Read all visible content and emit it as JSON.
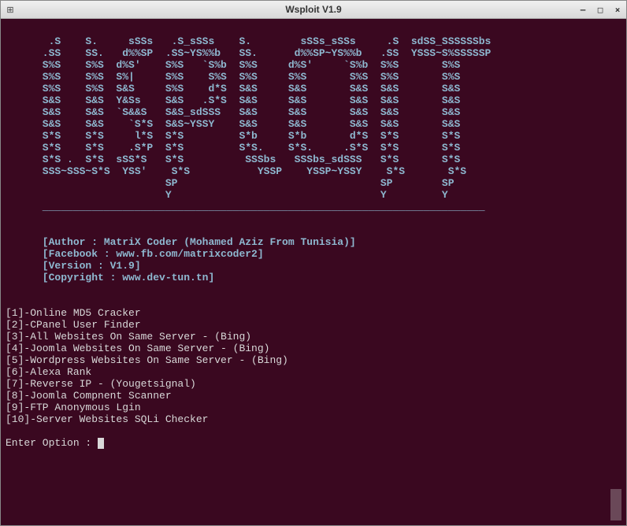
{
  "window": {
    "title": "Wsploit V1.9"
  },
  "ascii_art": "       .S    S.     sSSs   .S_sSSs    S.        sSSs_sSSs     .S  sdSS_SSSSSSbs\n      .SS    SS.   d%%SP  .SS~YS%%b   SS.      d%%SP~YS%%b   .SS  YSSS~S%SSSSSP\n      S%S    S%S  d%S'    S%S   `S%b  S%S     d%S'     `S%b  S%S       S%S\n      S%S    S%S  S%|     S%S    S%S  S%S     S%S       S%S  S%S       S%S\n      S%S    S%S  S&S     S%S    d*S  S&S     S&S       S&S  S&S       S&S\n      S&S    S&S  Y&Ss    S&S   .S*S  S&S     S&S       S&S  S&S       S&S\n      S&S    S&S  `S&&S   S&S_sdSSS   S&S     S&S       S&S  S&S       S&S\n      S&S    S&S    `S*S  S&S~YSSY    S&S     S&S       S&S  S&S       S&S\n      S*S    S*S     l*S  S*S         S*b     S*b       d*S  S*S       S*S\n      S*S    S*S    .S*P  S*S         S*S.    S*S.     .S*S  S*S       S*S\n      S*S .  S*S  sSS*S   S*S          SSSbs   SSSbs_sdSSS   S*S       S*S\n      SSS~SSS~S*S  YSS'    S*S           YSSP    YSSP~YSSY    S*S       S*S\n                          SP                                 SP        SP\n                          Y                                  Y         Y",
  "underline": "      ________________________________________________________________________",
  "info": {
    "author": "      [Author : MatriX Coder (Mohamed Aziz From Tunisia)]",
    "facebook": "      [Facebook : www.fb.com/matrixcoder2]",
    "version": "      [Version : V1.9]",
    "copyright": "      [Copyright : www.dev-tun.tn]"
  },
  "menu": {
    "item1": "[1]-Online MD5 Cracker",
    "item2": "[2]-CPanel User Finder",
    "item3": "[3]-All Websites On Same Server - (Bing)",
    "item4": "[4]-Joomla Websites On Same Server - (Bing)",
    "item5": "[5]-Wordpress Websites On Same Server - (Bing)",
    "item6": "[6]-Alexa Rank",
    "item7": "[7]-Reverse IP - (Yougetsignal)",
    "item8": "[8]-Joomla Compnent Scanner",
    "item9": "[9]-FTP Anonymous Lgin",
    "item10": "[10]-Server Websites SQLi Checker"
  },
  "prompt": "Enter Option : "
}
